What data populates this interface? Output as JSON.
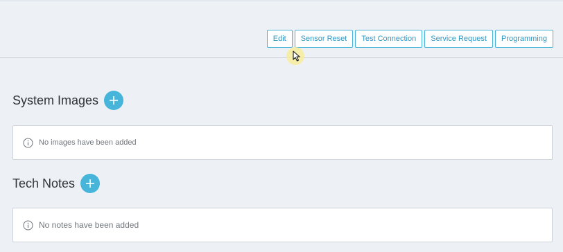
{
  "toolbar": {
    "buttons": [
      {
        "label": "Edit"
      },
      {
        "label": "Sensor Reset"
      },
      {
        "label": "Test Connection"
      },
      {
        "label": "Service Request"
      },
      {
        "label": "Programming"
      }
    ]
  },
  "system_images": {
    "title": "System Images",
    "empty_message": "No images have been added"
  },
  "tech_notes": {
    "title": "Tech Notes",
    "empty_message": "No notes have been added"
  },
  "icons": {
    "add": "plus-circle-icon",
    "info": "info-circle-icon",
    "cursor": "mouse-pointer-icon"
  },
  "colors": {
    "accent": "#46b5d9",
    "button_border": "#47b3d9",
    "button_text": "#2f97c4",
    "background": "#edf0f5"
  }
}
